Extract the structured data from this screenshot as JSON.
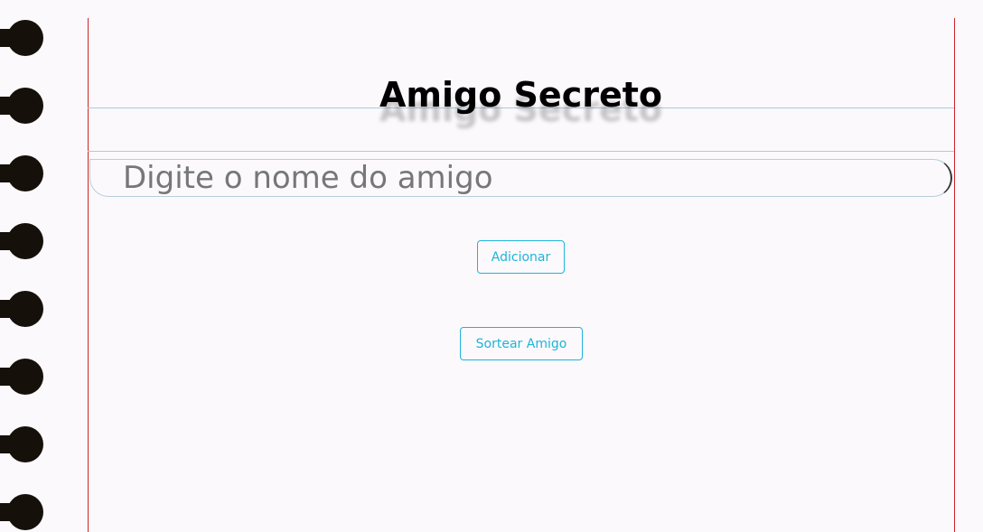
{
  "app": {
    "title": "Amigo Secreto"
  },
  "form": {
    "name_placeholder": "Digite o nome do amigo",
    "name_value": ""
  },
  "actions": {
    "add_label": "Adicionar",
    "draw_label": "Sortear Amigo"
  },
  "colors": {
    "page_background": "#fcf9fc",
    "margin_line": "#c9262c",
    "rule_line": "#a9cde0",
    "button_accent": "#1cb5d9",
    "ring": "#15100a"
  }
}
